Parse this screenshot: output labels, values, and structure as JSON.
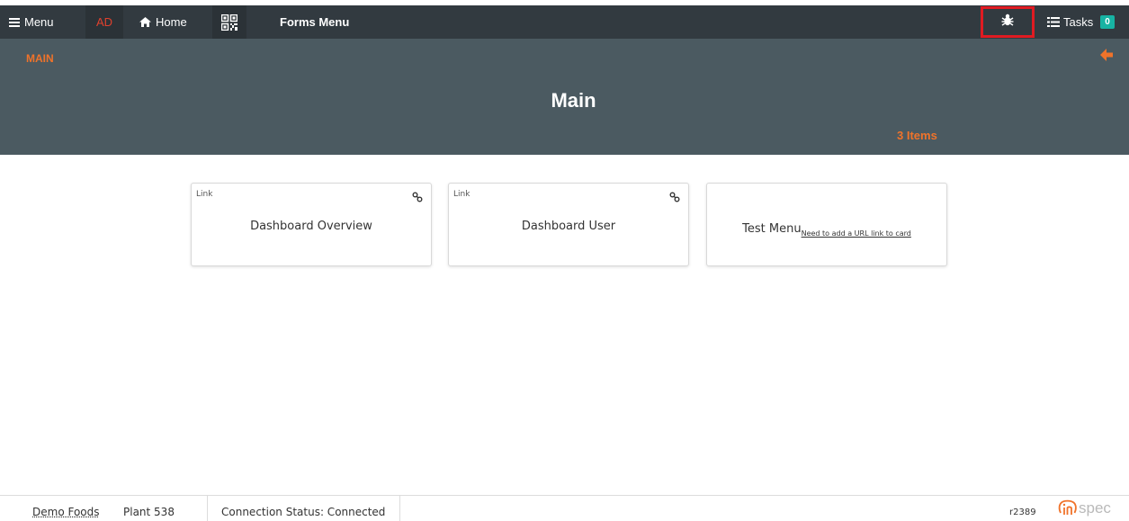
{
  "topbar": {
    "menu_label": "Menu",
    "avatar_initials": "AD",
    "home_label": "Home",
    "forms_menu_label": "Forms Menu",
    "tasks_label": "Tasks",
    "tasks_count": "0",
    "icons": [
      "hamburger-icon",
      "home-icon",
      "qr-code-icon",
      "bug-icon",
      "tasks-icon"
    ],
    "colors": {
      "bar": "#323a40",
      "avatar_text": "#e0412e",
      "badge": "#17b3a3",
      "highlight": "#e01b22"
    }
  },
  "header": {
    "breadcrumb": "MAIN",
    "title": "Main",
    "item_count": "3 Items",
    "icons": [
      "back-arrow-icon"
    ],
    "colors": {
      "band": "#4b5a61",
      "accent": "#f0732a"
    }
  },
  "cards": [
    {
      "type": "Link",
      "title": "Dashboard Overview",
      "icon": "link-icon"
    },
    {
      "type": "Link",
      "title": "Dashboard User",
      "icon": "link-icon"
    },
    {
      "type": "",
      "title": "Test Menu",
      "note": "Need to add a URL link to card"
    }
  ],
  "footer": {
    "company": "Demo Foods",
    "plant": "Plant 538",
    "connection": "Connection Status: Connected",
    "revision": "r2389",
    "logo_text": "spec"
  }
}
